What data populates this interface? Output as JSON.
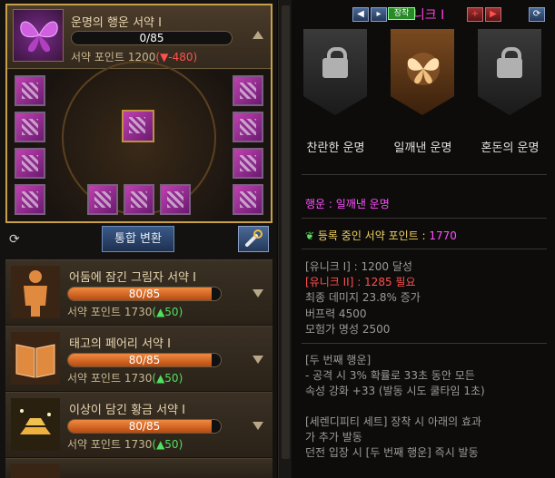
{
  "main_contract": {
    "title": "운명의 행운 서약 I",
    "progress": "0/85",
    "progress_fraction": 0.0,
    "points_label": "서약 포인트",
    "points_value": "1200",
    "points_delta": "(▼-480)"
  },
  "buttons": {
    "merge": "통합 변환"
  },
  "contracts": [
    {
      "title": "어둠에 잠긴 그림자 서약 I",
      "progress": "80/85",
      "fraction": 0.94,
      "points_label": "서약 포인트",
      "points_value": "1730",
      "points_delta": "(▲50)"
    },
    {
      "title": "태고의 페어리 서약 I",
      "progress": "80/85",
      "fraction": 0.94,
      "points_label": "서약 포인트",
      "points_value": "1730",
      "points_delta": "(▲50)"
    },
    {
      "title": "이상이 담긴 황금 서약 I",
      "progress": "80/85",
      "fraction": 0.94,
      "points_label": "서약 포인트",
      "points_value": "1730",
      "points_delta": "(▲50)"
    }
  ],
  "right": {
    "rarity": "유니크 I",
    "fates": [
      {
        "label": "찬란한 운명",
        "state": "locked"
      },
      {
        "label": "일깨낸 운명",
        "state": "active",
        "badge": "장착"
      },
      {
        "label": "혼돈의 운명",
        "state": "locked"
      }
    ],
    "fortune_line": "행운 : 일깨낸 운명",
    "registered_label": "등록 중인 서약 포인트 :",
    "registered_value": "1770",
    "lines": [
      {
        "text": "[유니크 I] : 1200 달성",
        "color": "gray"
      },
      {
        "text": "[유니크 II] : 1285 필요",
        "color": "red"
      },
      {
        "text": "최종 데미지 23.8% 증가",
        "color": "gray"
      },
      {
        "text": "버프력 4500",
        "color": "gray"
      },
      {
        "text": "모험가 명성 2500",
        "color": "gray"
      }
    ],
    "effect_title": "[두 번째 행운]",
    "effect_lines": [
      "- 공격 시 3% 확률로 33초 동안 모든",
      "속성 강화 +33 (발동 시도 쿨타임 1초)"
    ],
    "set_lines": [
      "[세렌디피티 세트] 장착 시 아래의 효과",
      "가 추가 발동",
      "던전 입장 시 [두 번째 행운] 즉시 발동"
    ]
  },
  "colors": {
    "accent_gold": "#c9a04a",
    "unique_magenta": "#ff40e0",
    "progress_orange": "#f08a40"
  }
}
